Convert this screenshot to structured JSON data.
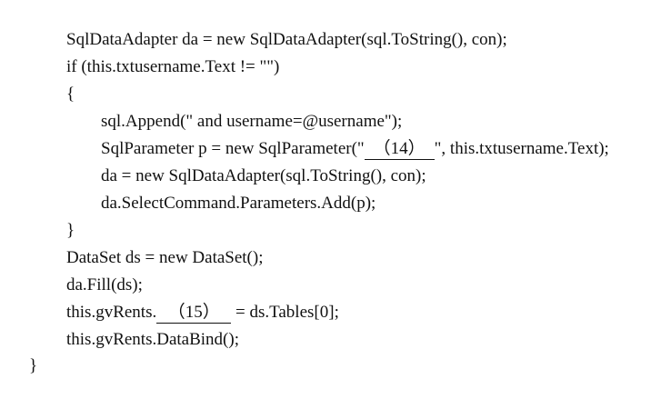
{
  "code_lines": [
    "SqlDataAdapter da = new SqlDataAdapter(sql.ToString(), con);",
    "if (this.txtusername.Text != \"\")",
    "{",
    "sql.Append(\" and username=@username\");",
    {
      "before": "SqlParameter p = new SqlParameter(\"",
      "blank": "（14）",
      "after": "\", this.txtusername.Text);"
    },
    "da = new SqlDataAdapter(sql.ToString(), con);",
    "da.SelectCommand.Parameters.Add(p);",
    "}",
    "DataSet ds = new DataSet();",
    "da.Fill(ds);",
    {
      "before": "this.gvRents.",
      "blank": "（15）",
      "after": " = ds.Tables[0];"
    },
    "this.gvRents.DataBind();",
    "}"
  ]
}
